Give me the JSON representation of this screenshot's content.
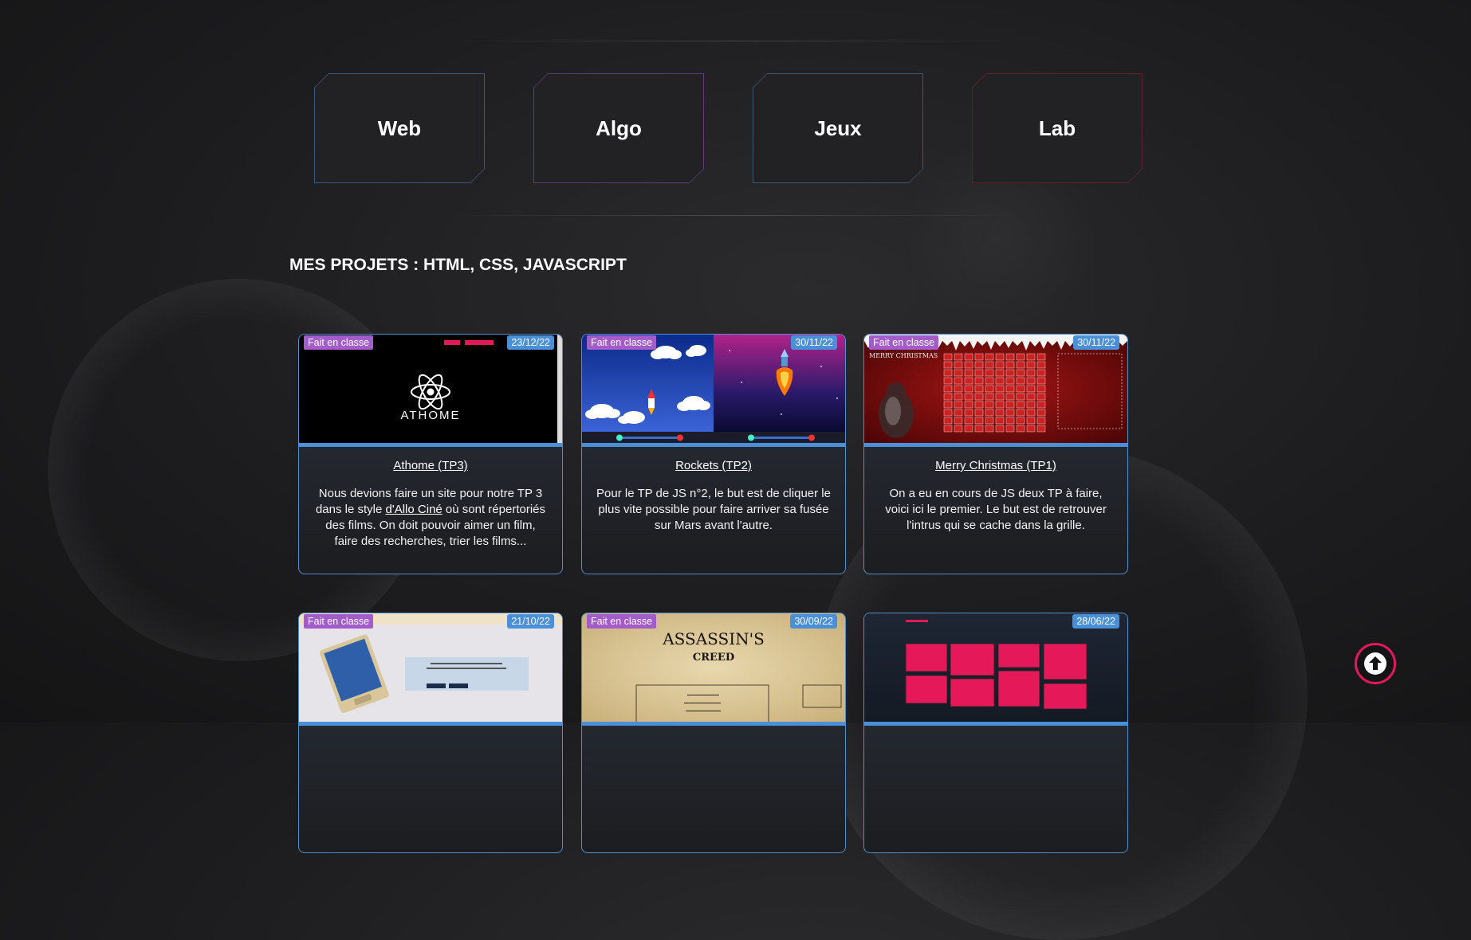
{
  "categories": [
    {
      "label": "Web",
      "color": "#3c5886"
    },
    {
      "label": "Algo",
      "color": "#5f3a80"
    },
    {
      "label": "Jeux",
      "color": "#3c5a78"
    },
    {
      "label": "Lab",
      "color": "#6a2028"
    }
  ],
  "section": {
    "title": "MES PROJETS : HTML, CSS, JAVASCRIPT"
  },
  "projects": [
    {
      "badge": "Fait en classe",
      "date": "23/12/22",
      "title": "Athome (TP3)",
      "desc_before": "Nous devions faire un site pour notre TP 3 dans le style ",
      "desc_link": "d'Allo Ciné",
      "desc_after": " où sont répertoriés des films. On doit pouvoir aimer un film, faire des recherches, trier les films...",
      "thumb_logo": "ATHOME"
    },
    {
      "badge": "Fait en classe",
      "date": "30/11/22",
      "title": "Rockets (TP2)",
      "desc": "Pour le TP de JS n°2, le but est de cliquer le plus vite possible pour faire arriver sa fusée sur Mars avant l'autre."
    },
    {
      "badge": "Fait en classe",
      "date": "30/11/22",
      "title": "Merry Christmas (TP1)",
      "desc": "On a eu en cours de JS deux TP à faire, voici ici le premier. Le but est de retrouver l'intrus qui se cache dans la grille.",
      "thumb_text": "MERRY CHRISTMAS"
    },
    {
      "badge": "Fait en classe",
      "date": "21/10/22"
    },
    {
      "badge": "Fait en classe",
      "date": "30/09/22",
      "thumb_title": "ASSASSIN'S",
      "thumb_subtitle": "CREED"
    },
    {
      "date": "28/06/22"
    }
  ],
  "colors": {
    "accent_blue": "#4a90d9",
    "badge_purple": "#a35cc9",
    "scroll_top_ring": "#e5185a"
  },
  "icons": {
    "scroll_top": "arrow-up-circle-icon",
    "athome_logo": "atom-icon",
    "rocket": "rocket-icon"
  }
}
